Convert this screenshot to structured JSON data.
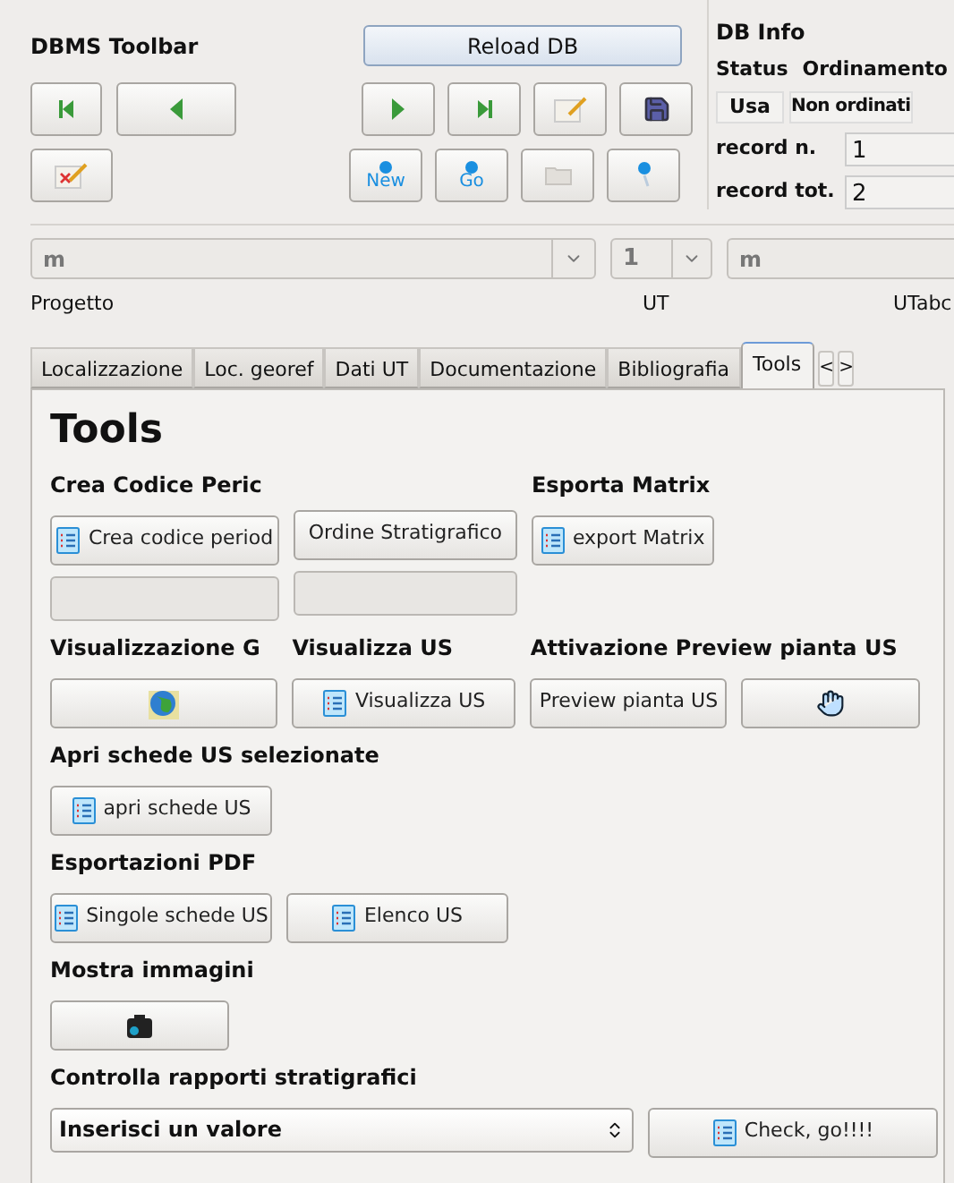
{
  "toolbar": {
    "title": "DBMS Toolbar",
    "reload_button": "Reload DB",
    "buttons": [
      {
        "kind": "first"
      },
      {
        "kind": "prev"
      },
      {
        "kind": "next"
      },
      {
        "kind": "last"
      },
      {
        "kind": "edit"
      },
      {
        "kind": "save"
      },
      {
        "kind": "delete"
      },
      {
        "kind": "new",
        "label": "New"
      },
      {
        "kind": "go",
        "label": "Go"
      },
      {
        "kind": "open"
      },
      {
        "kind": "search"
      }
    ]
  },
  "db_info": {
    "title": "DB Info",
    "status_label": "Status",
    "ordering_label": "Ordinamento",
    "status_value": "Usa",
    "ordering_value": "Non ordinati",
    "record_n_label": "record n.",
    "record_n_value": "1",
    "record_tot_label": "record tot.",
    "record_tot_value": "2"
  },
  "selectors": {
    "project_value": "m",
    "ut_value": "1",
    "utabc_value": "m",
    "project_label": "Progetto",
    "ut_label": "UT",
    "utabc_label": "UTabc"
  },
  "tabs": [
    {
      "label": "Localizzazione",
      "selected": false
    },
    {
      "label": "Loc. georef",
      "selected": false
    },
    {
      "label": "Dati UT",
      "selected": false
    },
    {
      "label": "Documentazione",
      "selected": false
    },
    {
      "label": "Bibliografia",
      "selected": false
    },
    {
      "label": "Tools",
      "selected": true
    }
  ],
  "tab_scroll": [
    "<",
    ">"
  ],
  "tools": {
    "heading": "Tools",
    "grid_rows": [
      [
        {
          "title": "Crea Codice Peric",
          "items": [
            {
              "kind": "list_button",
              "label": "Crea codice period"
            },
            {
              "kind": "field"
            }
          ]
        },
        {
          "items": [
            {
              "kind": "button",
              "label": "Ordine Stratigrafico"
            },
            {
              "kind": "field"
            }
          ]
        },
        {
          "title": "Esporta Matrix",
          "items": [
            {
              "kind": "list_button",
              "label": "export Matrix"
            }
          ]
        }
      ],
      [
        {
          "title": "Visualizzazione G",
          "items": [
            {
              "kind": "globe_button"
            }
          ]
        },
        {
          "title": "Visualizza US",
          "items": [
            {
              "kind": "list_button",
              "label": "Visualizza US"
            }
          ]
        },
        {
          "title": "Attivazione Preview pianta US",
          "items": [
            {
              "kind": "button",
              "label": "Preview pianta US"
            },
            {
              "kind": "hand_button"
            }
          ]
        }
      ]
    ],
    "sections": [
      {
        "title": "Apri schede US selezionate",
        "items": [
          {
            "kind": "list_button",
            "label": "apri schede US"
          }
        ]
      },
      {
        "title": "Esportazioni PDF",
        "items": [
          {
            "kind": "list_button",
            "label": "Singole schede US"
          },
          {
            "kind": "list_button",
            "label": "Elenco US"
          }
        ]
      },
      {
        "title": "Mostra immagini",
        "items": [
          {
            "kind": "camera_button"
          }
        ]
      },
      {
        "title": "Controlla rapporti stratigrafici",
        "items": [
          {
            "kind": "combo",
            "label": "Inserisci un valore"
          },
          {
            "kind": "list_button",
            "label": "Check, go!!!!"
          }
        ]
      }
    ]
  }
}
